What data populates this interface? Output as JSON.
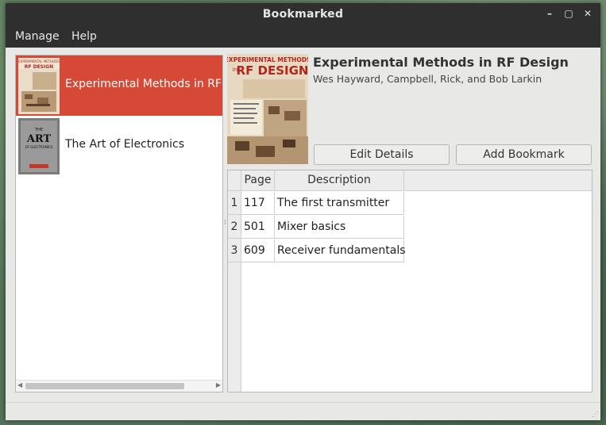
{
  "window": {
    "title": "Bookmarked",
    "minimize_glyph": "–",
    "maximize_glyph": "▢",
    "close_glyph": "✕"
  },
  "menu": [
    "Manage",
    "Help"
  ],
  "books": [
    {
      "title": "Experimental Methods in RF Design",
      "selected": true
    },
    {
      "title": "The Art of Electronics",
      "selected": false
    }
  ],
  "detail": {
    "title": "Experimental Methods in RF Design",
    "authors": "Wes Hayward, Campbell, Rick, and Bob Larkin",
    "edit_label": "Edit Details",
    "add_label": "Add Bookmark"
  },
  "bookmarks": {
    "columns": [
      "Page",
      "Description"
    ],
    "rows": [
      {
        "n": "1",
        "page": "117",
        "desc": "The first transmitter"
      },
      {
        "n": "2",
        "page": "501",
        "desc": "Mixer basics"
      },
      {
        "n": "3",
        "page": "609",
        "desc": "Receiver fundamentals"
      }
    ]
  },
  "covers": {
    "rf": {
      "line1": "EXPERIMENTAL METHODS",
      "line2": "in",
      "line3": "RF DESIGN"
    },
    "art": {
      "line1": "THE",
      "line2": "ART",
      "line3": "OF ELECTRONICS"
    }
  },
  "colors": {
    "accent": "#d64937",
    "titlebar": "#2f2f2f"
  }
}
